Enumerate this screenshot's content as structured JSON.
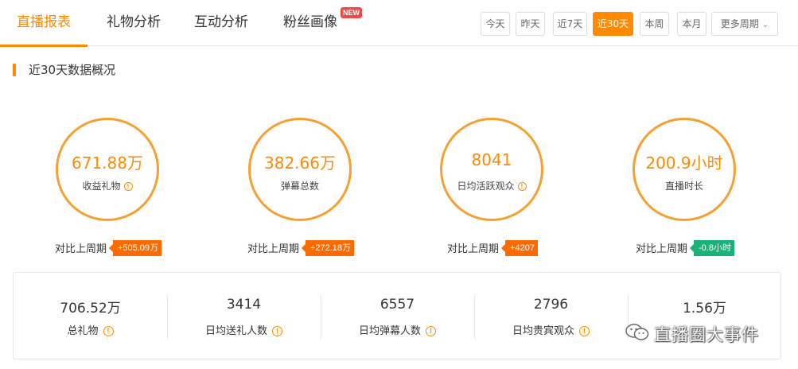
{
  "tabs": [
    {
      "label": "直播报表",
      "active": true
    },
    {
      "label": "礼物分析",
      "active": false
    },
    {
      "label": "互动分析",
      "active": false
    },
    {
      "label": "粉丝画像",
      "active": false,
      "badge": "NEW"
    }
  ],
  "periods": [
    {
      "label": "今天",
      "active": false
    },
    {
      "label": "昨天",
      "active": false
    },
    {
      "label": "近7天",
      "active": false
    },
    {
      "label": "近30天",
      "active": true
    },
    {
      "label": "本周",
      "active": false
    },
    {
      "label": "本月",
      "active": false
    },
    {
      "label": "更多周期",
      "active": false,
      "dropdown": true
    }
  ],
  "section": {
    "title": "近30天数据概况"
  },
  "metrics": [
    {
      "value": "671.88万",
      "label": "收益礼物",
      "has_info": true,
      "compare_label": "对比上周期",
      "delta": "+505.09万",
      "trend": "up"
    },
    {
      "value": "382.66万",
      "label": "弹幕总数",
      "has_info": false,
      "compare_label": "对比上周期",
      "delta": "+272.18万",
      "trend": "up"
    },
    {
      "value": "8041",
      "label": "日均活跃观众",
      "has_info": true,
      "compare_label": "对比上周期",
      "delta": "+4207",
      "trend": "up"
    },
    {
      "value": "200.9小时",
      "label": "直播时长",
      "has_info": false,
      "compare_label": "对比上周期",
      "delta": "-0.8小时",
      "trend": "down"
    }
  ],
  "stats": [
    {
      "value": "706.52万",
      "label": "总礼物"
    },
    {
      "value": "3414",
      "label": "日均送礼人数"
    },
    {
      "value": "6557",
      "label": "日均弹幕人数"
    },
    {
      "value": "2796",
      "label": "日均贵宾观众"
    },
    {
      "value": "1.56万",
      "label": ""
    }
  ],
  "info_glyph": "!",
  "watermark": {
    "text": "直播圈大事件",
    "icon": "wechat-icon"
  },
  "colors": {
    "accent": "#ff8a00",
    "up": "#ff6a00",
    "down": "#19b37a"
  }
}
